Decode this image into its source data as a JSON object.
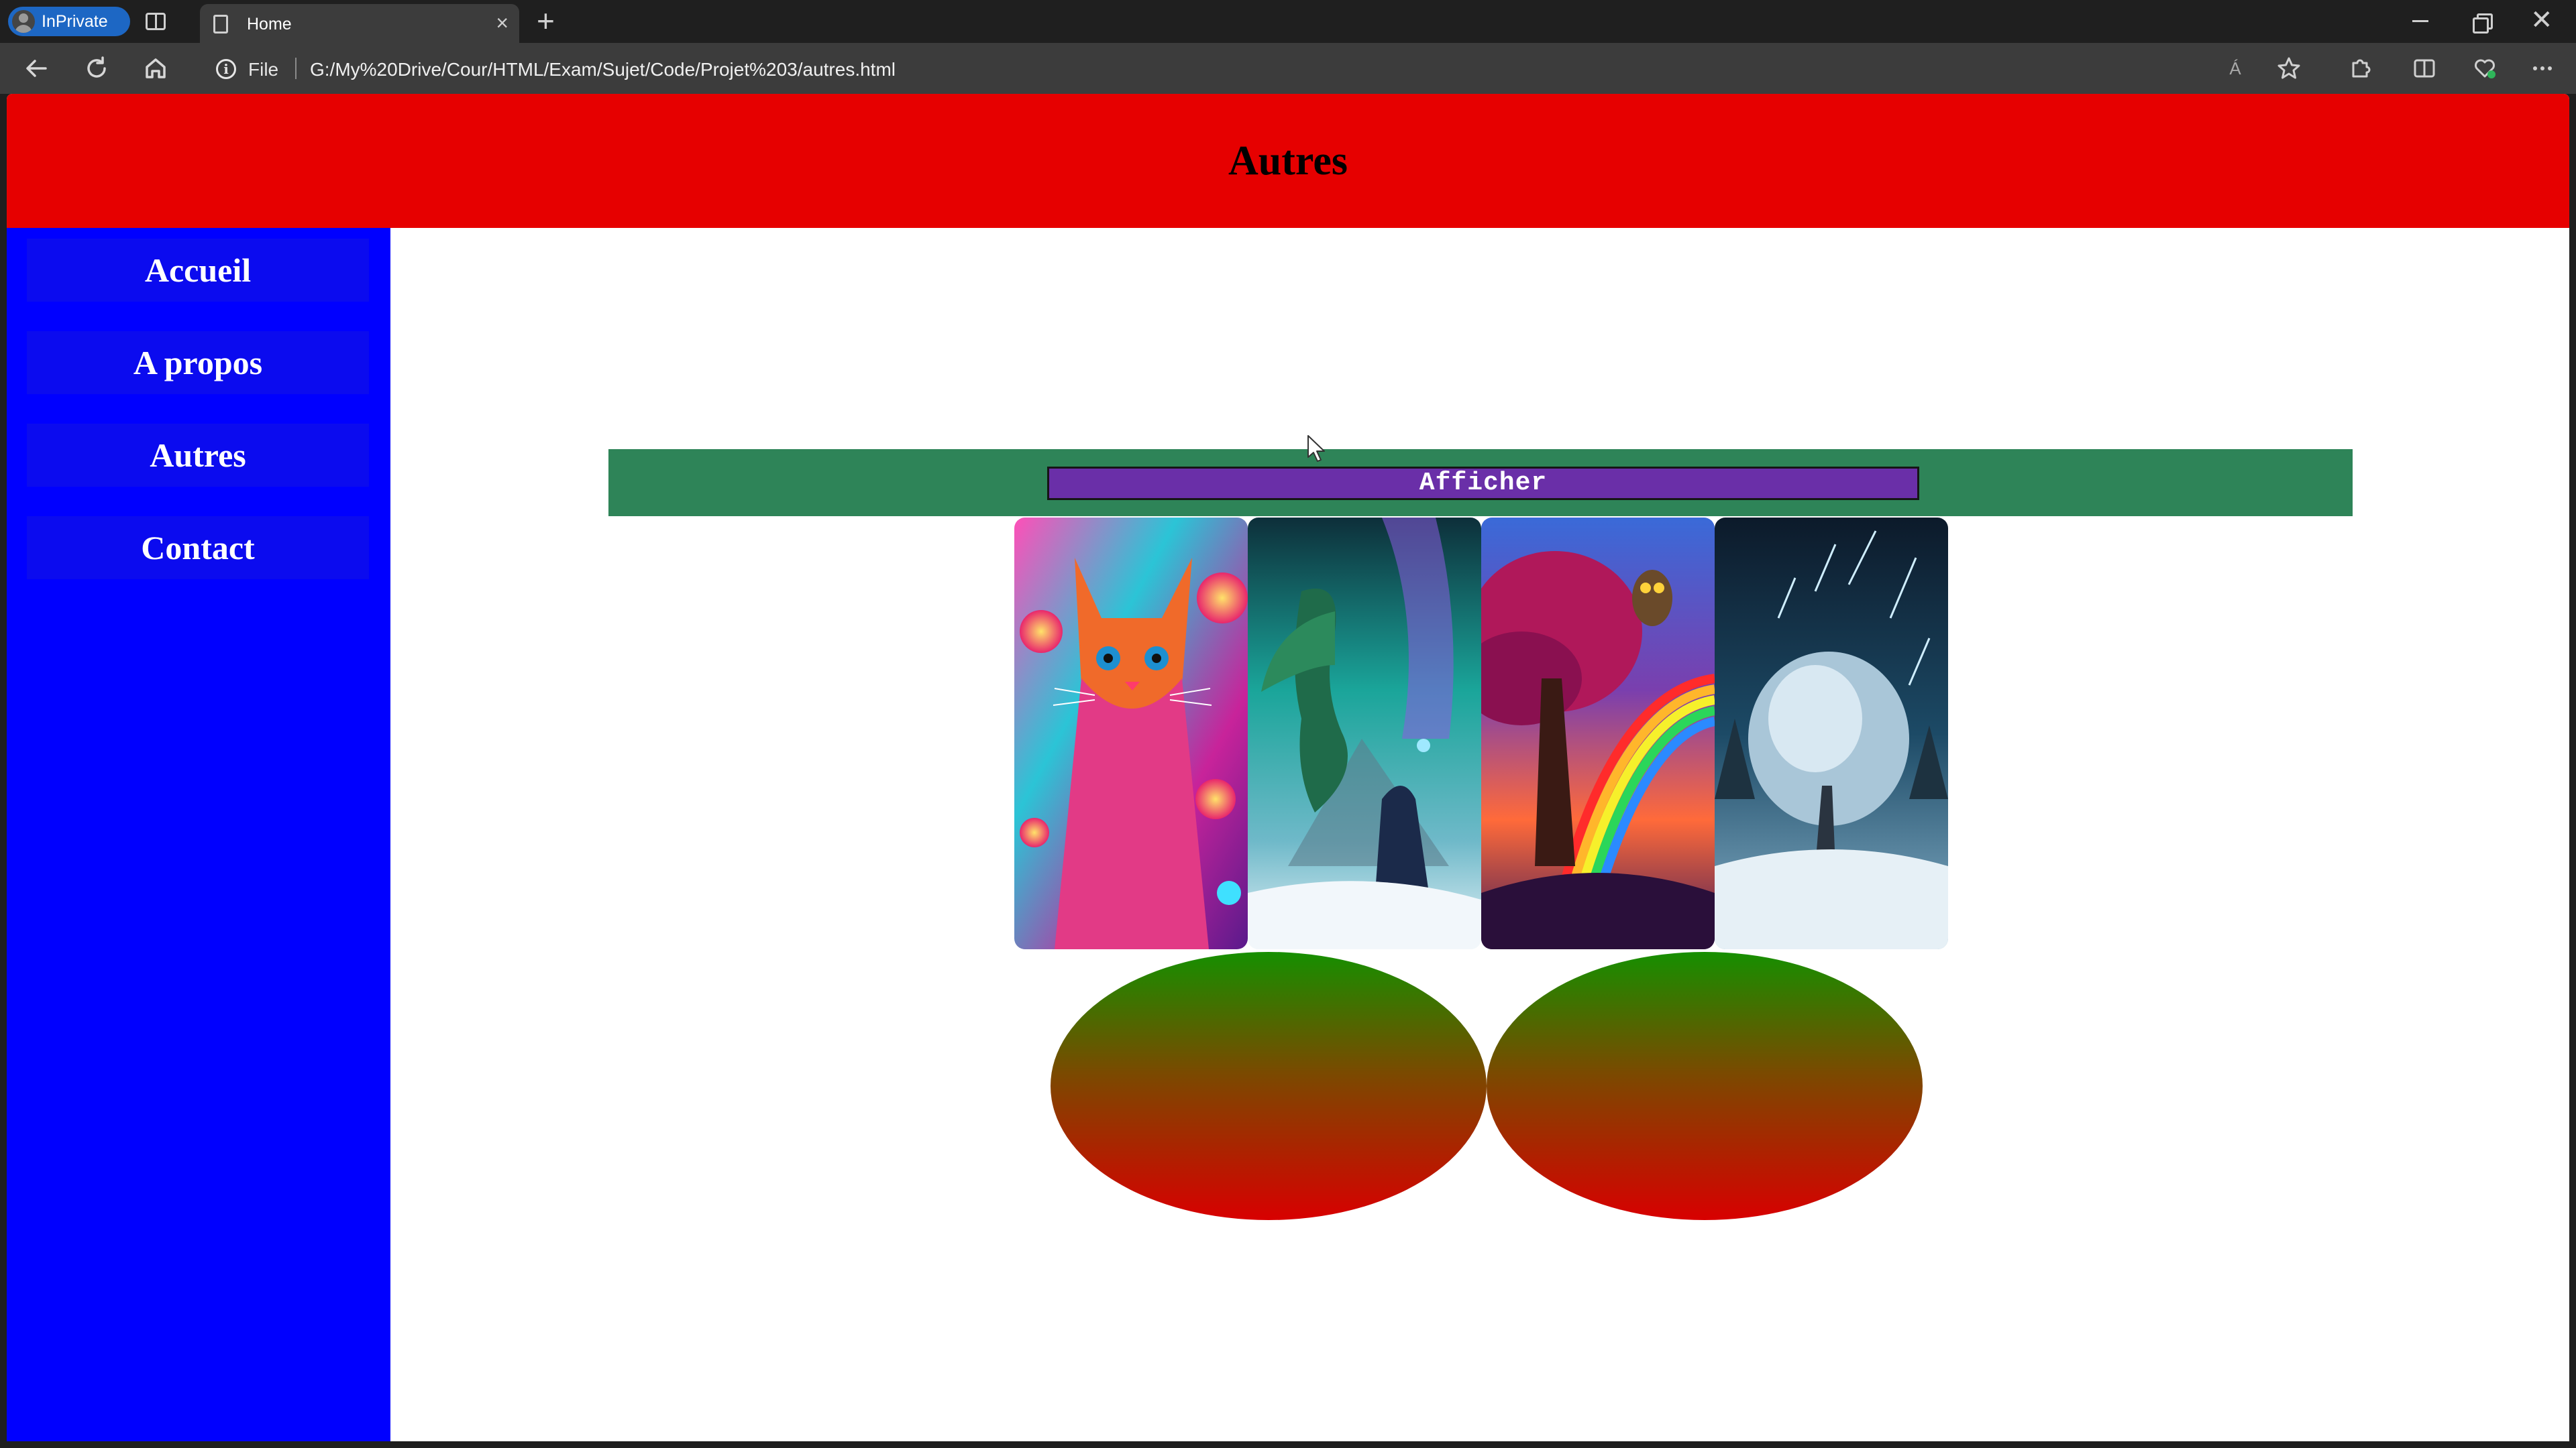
{
  "browser": {
    "profile_label": "InPrivate",
    "tab_title": "Home",
    "tab_close": "×",
    "new_tab": "+",
    "file_label": "File",
    "url": "G:/My%20Drive/Cour/HTML/Exam/Sujet/Code/Projet%203/autres.html",
    "read_aloud": "Á",
    "window_close": "✕"
  },
  "page": {
    "header_title": "Autres",
    "nav": [
      "Accueil",
      "A propos",
      "Autres",
      "Contact"
    ],
    "button_label": "Afficher",
    "gallery": [
      {
        "icon": "psychedelic-cat-image"
      },
      {
        "icon": "dragon-aurora-image"
      },
      {
        "icon": "rainbow-tree-owl-image"
      },
      {
        "icon": "snowy-tree-meteor-image"
      }
    ]
  },
  "colors": {
    "header": "#e60000",
    "sidebar": "#0000ff",
    "button_bar": "#2e8458",
    "button": "#6a2fa8",
    "ellipse_top": "#168f00",
    "ellipse_bottom": "#d80000"
  }
}
